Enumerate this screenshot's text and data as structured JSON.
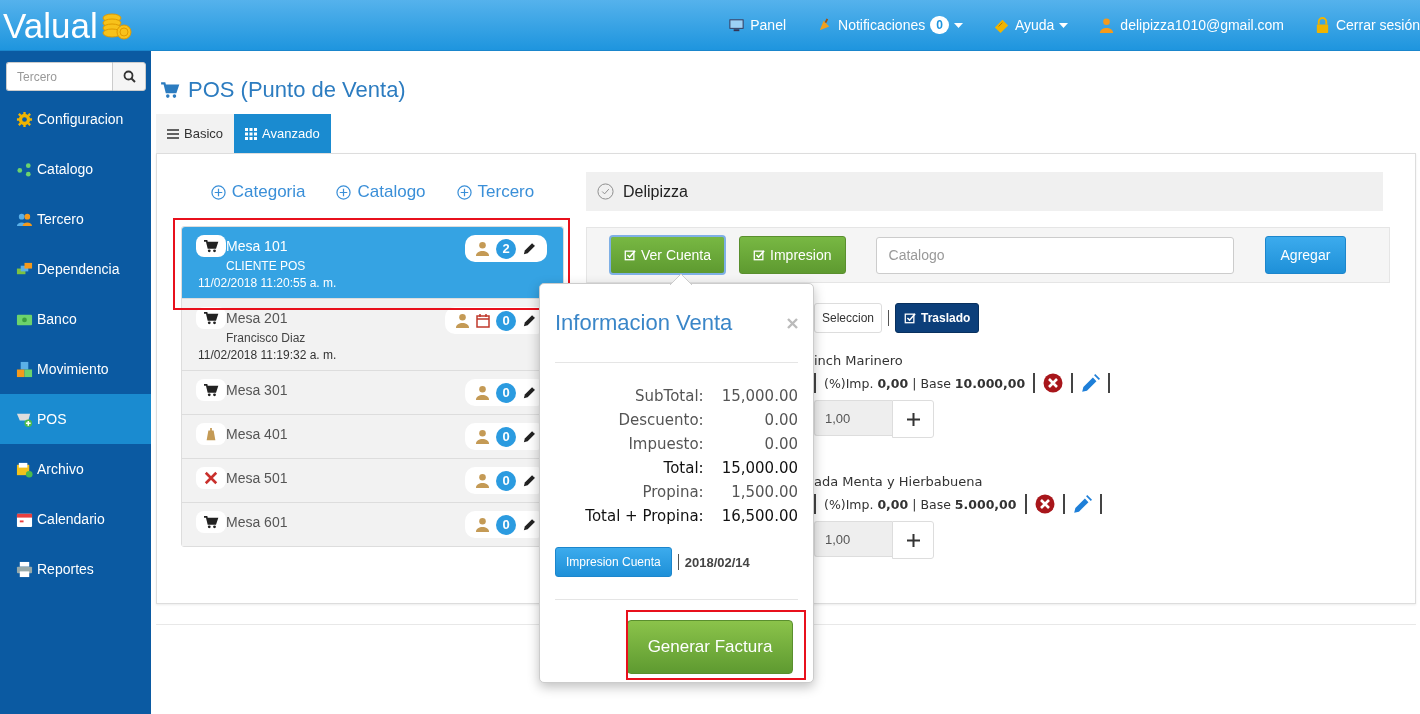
{
  "topbar": {
    "logo": "Valual",
    "nav": [
      {
        "label": "Panel",
        "dropdown": false
      },
      {
        "label": "Notificaciones",
        "badge": "0",
        "dropdown": true
      },
      {
        "label": "Ayuda",
        "dropdown": true
      },
      {
        "label": "delipizza1010@gmail.com",
        "dropdown": false
      },
      {
        "label": "Cerrar sesión",
        "dropdown": false
      }
    ]
  },
  "sidebar": {
    "search": {
      "placeholder": "Tercero"
    },
    "items": [
      {
        "label": "Configuracion",
        "selected": false
      },
      {
        "label": "Catalogo",
        "selected": false
      },
      {
        "label": "Tercero",
        "selected": false
      },
      {
        "label": "Dependencia",
        "selected": false
      },
      {
        "label": "Banco",
        "selected": false
      },
      {
        "label": "Movimiento",
        "selected": false
      },
      {
        "label": "POS",
        "selected": true
      },
      {
        "label": "Archivo",
        "selected": false
      },
      {
        "label": "Calendario",
        "selected": false
      },
      {
        "label": "Reportes",
        "selected": false
      }
    ]
  },
  "page": {
    "title": "POS (Punto de Venta)",
    "tabs": [
      {
        "label": "Basico",
        "selected": false
      },
      {
        "label": "Avanzado",
        "selected": true
      }
    ]
  },
  "links": [
    "Categoria",
    "Catalogo",
    "Tercero"
  ],
  "tables": [
    {
      "name": "Mesa 101",
      "client": "CLIENTE POS",
      "time": "11/02/2018 11:20:55 a. m.",
      "kind": "cart",
      "count": "2",
      "reservation": false,
      "selected": true
    },
    {
      "name": "Mesa 201",
      "client": "Francisco Diaz",
      "time": "11/02/2018 11:19:32 a. m.",
      "kind": "cart",
      "count": "0",
      "reservation": true,
      "selected": false
    },
    {
      "name": "Mesa 301",
      "kind": "cart",
      "count": "0",
      "reservation": false,
      "selected": false
    },
    {
      "name": "Mesa 401",
      "kind": "bell",
      "count": "0",
      "reservation": false,
      "selected": false
    },
    {
      "name": "Mesa 501",
      "kind": "cancel",
      "count": "0",
      "reservation": false,
      "selected": false
    },
    {
      "name": "Mesa 601",
      "kind": "cart",
      "count": "0",
      "reservation": false,
      "selected": false
    }
  ],
  "order": {
    "company": "Delipizza",
    "buttons": [
      "Ver Cuenta",
      "Impresion"
    ],
    "catalog": {
      "placeholder": "Catalogo"
    },
    "add": "Agregar",
    "actions": [
      "Seleccion",
      "Traslado"
    ],
    "products": [
      {
        "name": "inch Marinero",
        "detail": "(%)Imp. **0,00** | Base **10.000,00**",
        "quantity": "1,00"
      },
      {
        "name": "ada Menta y Hierbabuena",
        "detail": "(%)Imp. **0,00** | Base **5.000,00**",
        "quantity": "1,00"
      }
    ]
  },
  "popover": {
    "title": "Informacion Venta",
    "rows": [
      {
        "label": "SubTotal:",
        "value": "15,000.00",
        "emphasis": false
      },
      {
        "label": "Descuento:",
        "value": "0.00",
        "emphasis": false
      },
      {
        "label": "Impuesto:",
        "value": "0.00",
        "emphasis": false
      },
      {
        "label": "Total:",
        "value": "15,000.00",
        "emphasis": true
      },
      {
        "label": "Propina:",
        "value": "1,500.00",
        "emphasis": false
      },
      {
        "label": "Total + Propina:",
        "value": "16,500.00",
        "emphasis": true
      }
    ],
    "print": "Impresion Cuenta",
    "date": "2018/02/14",
    "action": "Generar Factura"
  }
}
